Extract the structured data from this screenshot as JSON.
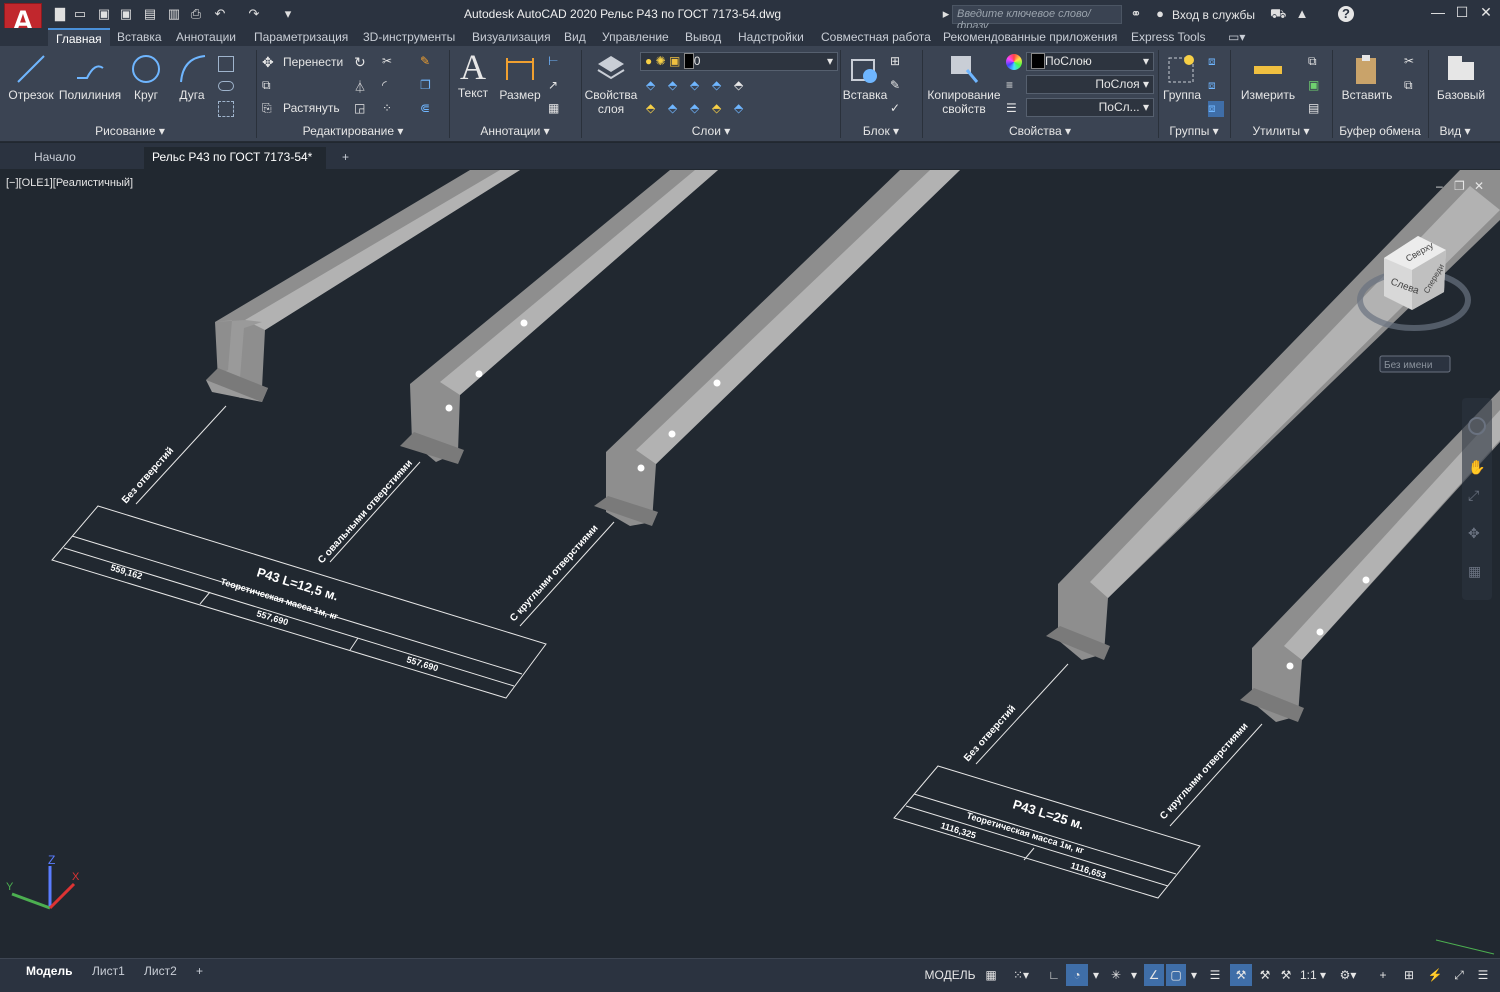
{
  "app": {
    "title": "Autodesk AutoCAD 2020   Рельс Р43 по ГОСТ 7173-54.dwg",
    "logo_letter": "A",
    "search_placeholder": "Введите ключевое слово/фразу",
    "signin": "Вход в службы",
    "help": "?"
  },
  "menu_tabs": [
    "Главная",
    "Вставка",
    "Аннотации",
    "Параметризация",
    "3D-инструменты",
    "Визуализация",
    "Вид",
    "Управление",
    "Вывод",
    "Надстройки",
    "Совместная работа",
    "Рекомендованные приложения",
    "Express Tools"
  ],
  "ribbon": {
    "draw": {
      "line": "Отрезок",
      "polyline": "Полилиния",
      "circle": "Круг",
      "arc": "Дуга",
      "label": "Рисование"
    },
    "modify": {
      "move": "Перенести",
      "stretch": "Растянуть",
      "label": "Редактирование"
    },
    "annotation": {
      "text": "Текст",
      "dimension": "Размер",
      "label": "Аннотации"
    },
    "layers": {
      "props": "Свойства",
      "props2": "слоя",
      "current": "0",
      "label": "Слои"
    },
    "block": {
      "insert": "Вставка",
      "label": "Блок"
    },
    "properties": {
      "match": "Копирование",
      "match2": "свойств",
      "color": "ПоСлою",
      "linetype": "ПоСлоя",
      "lineweight": "ПоСл...",
      "label": "Свойства"
    },
    "groups": {
      "group": "Группа",
      "label": "Группы"
    },
    "utilities": {
      "measure": "Измерить",
      "label": "Утилиты"
    },
    "clipboard": {
      "paste": "Вставить",
      "label": "Буфер обмена"
    },
    "view": {
      "base": "Базовый",
      "label": "Вид"
    }
  },
  "doc_tabs": {
    "start": "Начало",
    "current": "Рельс Р43 по ГОСТ 7173-54*",
    "add": "+"
  },
  "viewport": {
    "label": "[−][OLE1][Реалистичный]",
    "viewcube": {
      "top": "Сверху",
      "left": "Слева",
      "front": "Спереди",
      "wcs": "Без имени"
    }
  },
  "drawing": {
    "group1": {
      "leaders": [
        "Без отверстий",
        "С овальными отверстиями",
        "С круглыми отверстиями"
      ],
      "title": "Р43 L=12,5 м.",
      "subtitle": "Теоретическая масса 1м, кг",
      "v1": "559,162",
      "v2": "557,690",
      "v3": "557,690"
    },
    "group2": {
      "leaders": [
        "Без отверстий",
        "С круглыми отверстиями"
      ],
      "title": "Р43 L=25 м.",
      "subtitle": "Теоретическая масса 1м, кг",
      "v1": "1116,325",
      "v2": "1116,653"
    }
  },
  "status": {
    "tabs": [
      "Модель",
      "Лист1",
      "Лист2"
    ],
    "add": "+",
    "mode": "МОДЕЛЬ",
    "scale": "1:1"
  },
  "colors": {
    "accent": "#3f6ea8",
    "rail": "#9b9b9b",
    "bg": "#212830",
    "ribbon": "#3b4453"
  }
}
